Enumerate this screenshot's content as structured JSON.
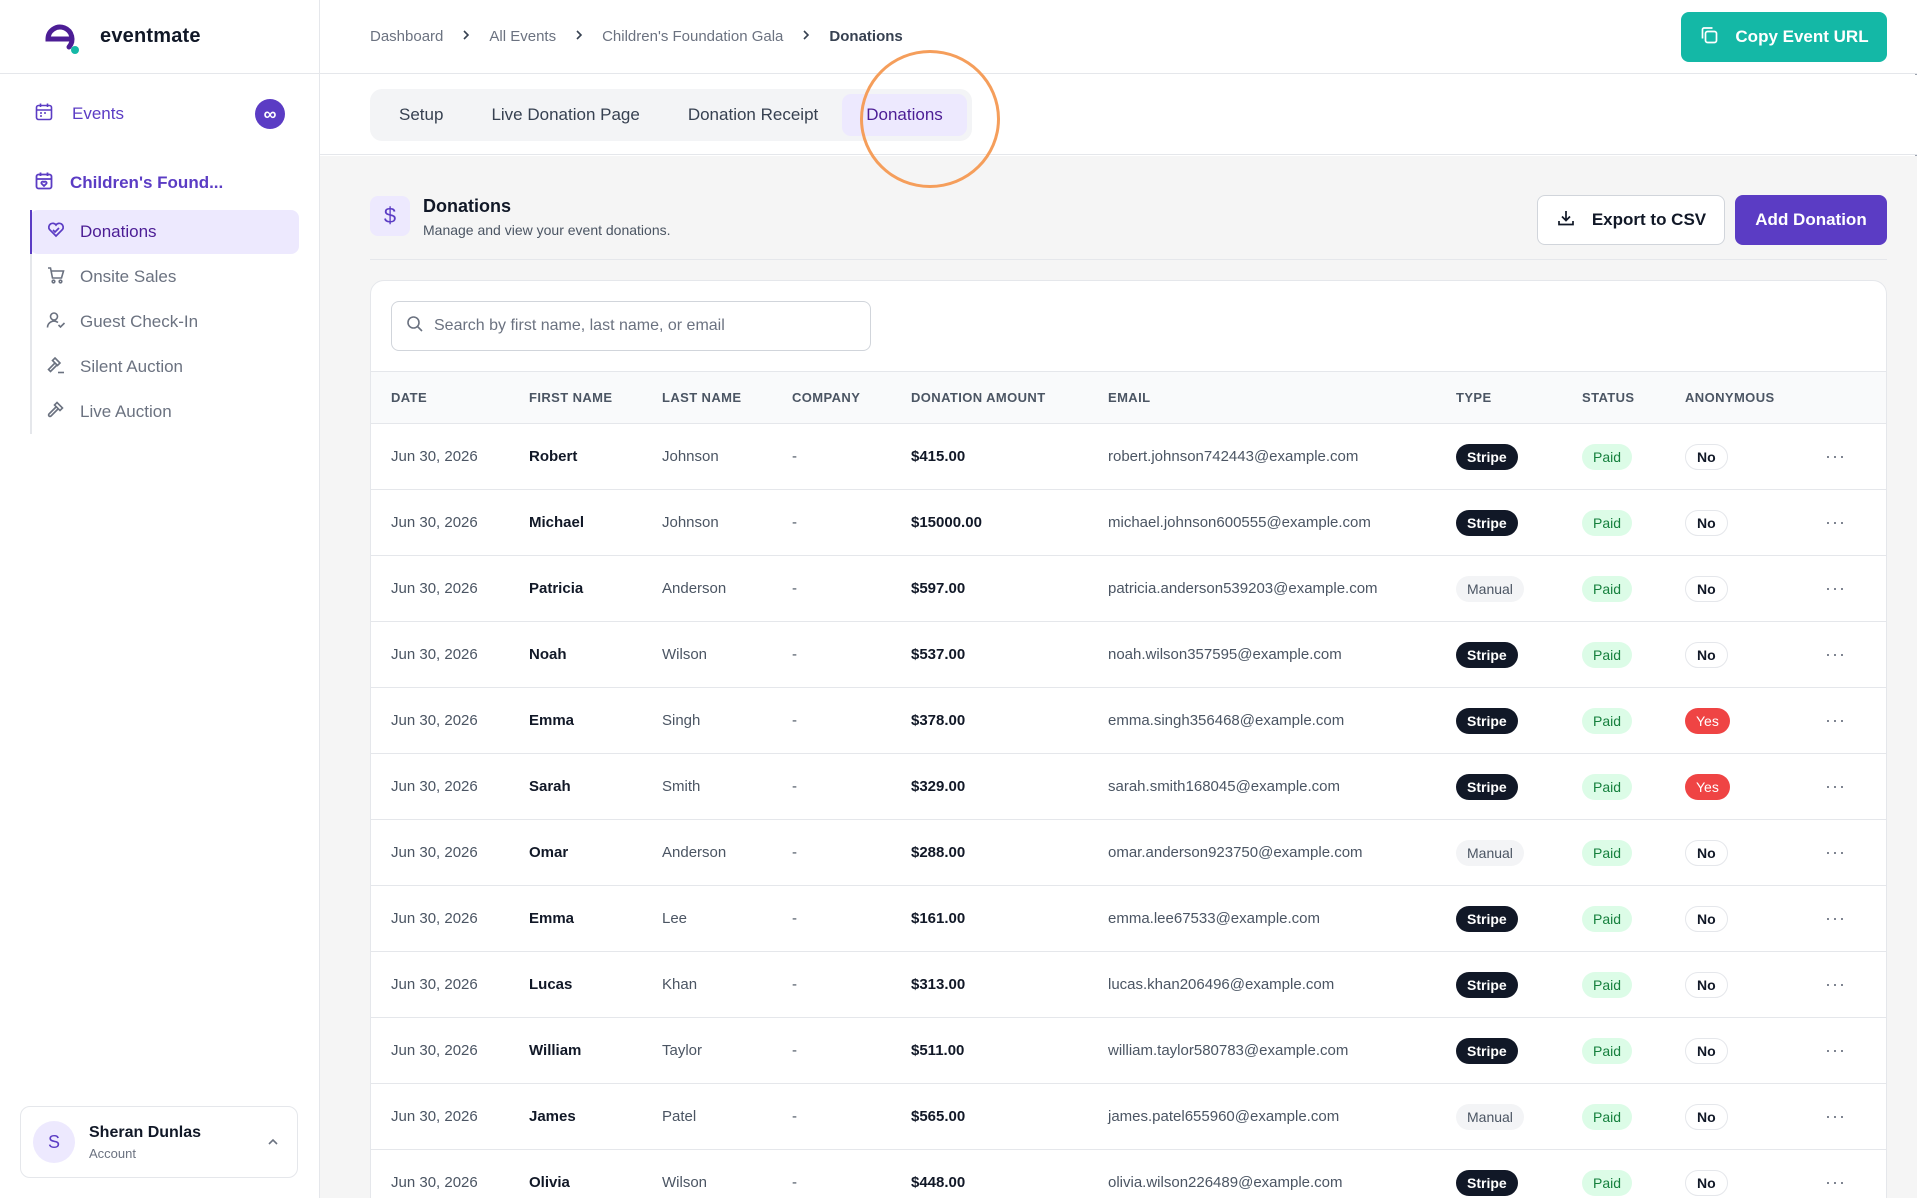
{
  "brand": {
    "name": "eventmate"
  },
  "sidebar": {
    "events_label": "Events",
    "events_badge": "∞",
    "event_name": "Children's Found...",
    "items": [
      {
        "label": "Donations",
        "icon": "heart-hand-icon",
        "active": true
      },
      {
        "label": "Onsite Sales",
        "icon": "cart-icon",
        "active": false
      },
      {
        "label": "Guest Check-In",
        "icon": "user-check-icon",
        "active": false
      },
      {
        "label": "Silent Auction",
        "icon": "gavel-icon",
        "active": false
      },
      {
        "label": "Live Auction",
        "icon": "hammer-icon",
        "active": false
      }
    ],
    "account": {
      "initial": "S",
      "name": "Sheran Dunlas",
      "sub": "Account"
    }
  },
  "breadcrumb": {
    "items": [
      "Dashboard",
      "All Events",
      "Children's Foundation Gala",
      "Donations"
    ]
  },
  "header": {
    "copy_url_label": "Copy Event URL"
  },
  "tabs": [
    {
      "label": "Setup",
      "active": false
    },
    {
      "label": "Live Donation Page",
      "active": false
    },
    {
      "label": "Donation Receipt",
      "active": false
    },
    {
      "label": "Donations",
      "active": true
    }
  ],
  "page": {
    "icon": "$",
    "title": "Donations",
    "subtitle": "Manage and view your event donations.",
    "export_label": "Export to CSV",
    "add_label": "Add Donation",
    "search_placeholder": "Search by first name, last name, or email"
  },
  "table": {
    "columns": [
      "Date",
      "First Name",
      "Last Name",
      "Company",
      "Donation Amount",
      "Email",
      "Type",
      "Status",
      "Anonymous"
    ],
    "rows": [
      {
        "date": "Jun 30, 2026",
        "first": "Robert",
        "last": "Johnson",
        "company": "-",
        "amount": "$415.00",
        "email": "robert.johnson742443@example.com",
        "type": "Stripe",
        "status": "Paid",
        "anonymous": "No"
      },
      {
        "date": "Jun 30, 2026",
        "first": "Michael",
        "last": "Johnson",
        "company": "-",
        "amount": "$15000.00",
        "email": "michael.johnson600555@example.com",
        "type": "Stripe",
        "status": "Paid",
        "anonymous": "No"
      },
      {
        "date": "Jun 30, 2026",
        "first": "Patricia",
        "last": "Anderson",
        "company": "-",
        "amount": "$597.00",
        "email": "patricia.anderson539203@example.com",
        "type": "Manual",
        "status": "Paid",
        "anonymous": "No"
      },
      {
        "date": "Jun 30, 2026",
        "first": "Noah",
        "last": "Wilson",
        "company": "-",
        "amount": "$537.00",
        "email": "noah.wilson357595@example.com",
        "type": "Stripe",
        "status": "Paid",
        "anonymous": "No"
      },
      {
        "date": "Jun 30, 2026",
        "first": "Emma",
        "last": "Singh",
        "company": "-",
        "amount": "$378.00",
        "email": "emma.singh356468@example.com",
        "type": "Stripe",
        "status": "Paid",
        "anonymous": "Yes"
      },
      {
        "date": "Jun 30, 2026",
        "first": "Sarah",
        "last": "Smith",
        "company": "-",
        "amount": "$329.00",
        "email": "sarah.smith168045@example.com",
        "type": "Stripe",
        "status": "Paid",
        "anonymous": "Yes"
      },
      {
        "date": "Jun 30, 2026",
        "first": "Omar",
        "last": "Anderson",
        "company": "-",
        "amount": "$288.00",
        "email": "omar.anderson923750@example.com",
        "type": "Manual",
        "status": "Paid",
        "anonymous": "No"
      },
      {
        "date": "Jun 30, 2026",
        "first": "Emma",
        "last": "Lee",
        "company": "-",
        "amount": "$161.00",
        "email": "emma.lee67533@example.com",
        "type": "Stripe",
        "status": "Paid",
        "anonymous": "No"
      },
      {
        "date": "Jun 30, 2026",
        "first": "Lucas",
        "last": "Khan",
        "company": "-",
        "amount": "$313.00",
        "email": "lucas.khan206496@example.com",
        "type": "Stripe",
        "status": "Paid",
        "anonymous": "No"
      },
      {
        "date": "Jun 30, 2026",
        "first": "William",
        "last": "Taylor",
        "company": "-",
        "amount": "$511.00",
        "email": "william.taylor580783@example.com",
        "type": "Stripe",
        "status": "Paid",
        "anonymous": "No"
      },
      {
        "date": "Jun 30, 2026",
        "first": "James",
        "last": "Patel",
        "company": "-",
        "amount": "$565.00",
        "email": "james.patel655960@example.com",
        "type": "Manual",
        "status": "Paid",
        "anonymous": "No"
      },
      {
        "date": "Jun 30, 2026",
        "first": "Olivia",
        "last": "Wilson",
        "company": "-",
        "amount": "$448.00",
        "email": "olivia.wilson226489@example.com",
        "type": "Stripe",
        "status": "Paid",
        "anonymous": "No"
      }
    ],
    "row_action": "···"
  },
  "colors": {
    "brand_purple": "#5b3cc4",
    "teal": "#14b8a6",
    "paid_green": "#dcfce7",
    "yes_red": "#ef4444",
    "highlight_ring": "#f59e5b"
  }
}
